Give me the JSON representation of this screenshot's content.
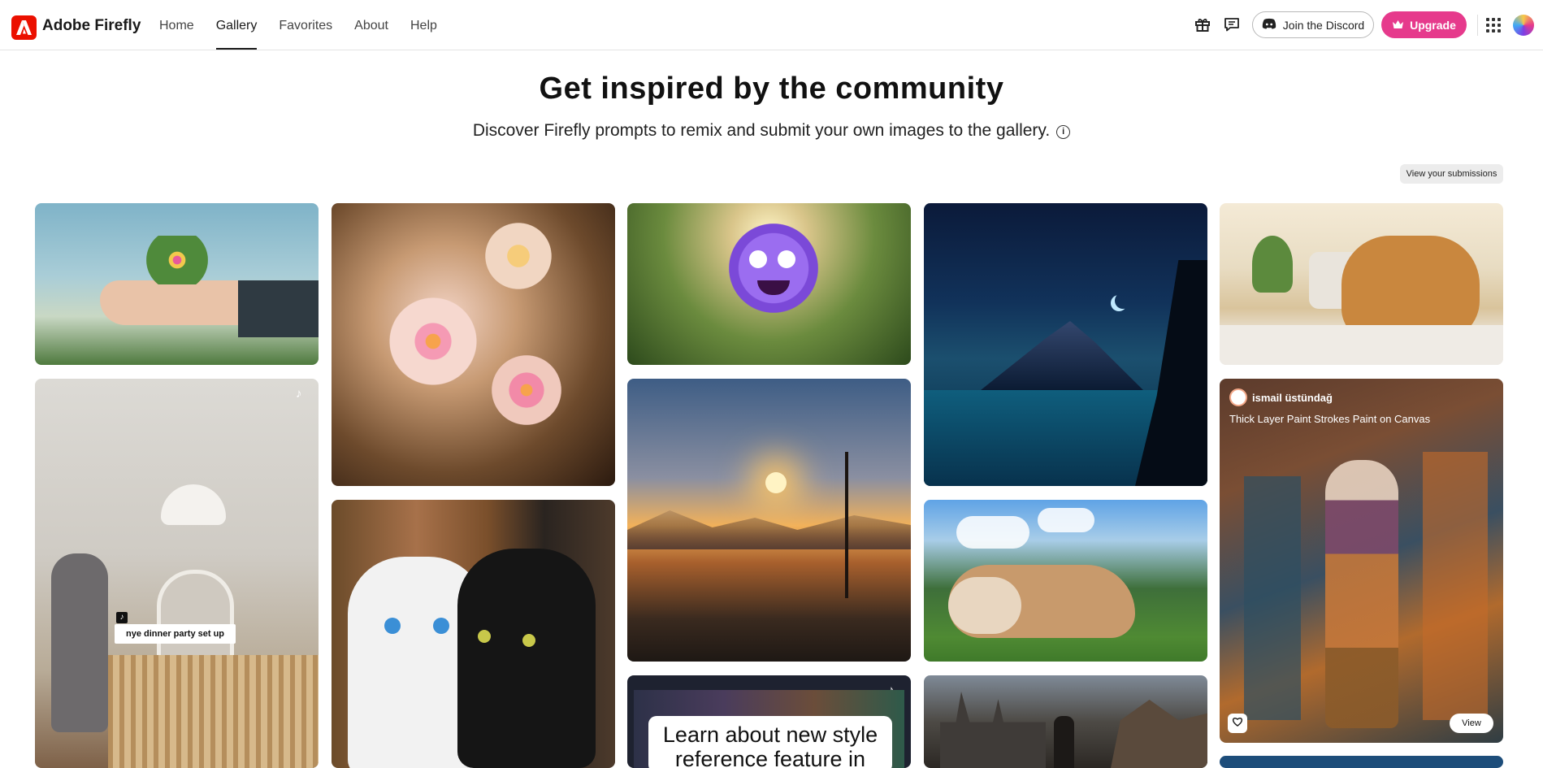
{
  "header": {
    "app_name": "Adobe Firefly",
    "nav": [
      {
        "label": "Home",
        "active": false
      },
      {
        "label": "Gallery",
        "active": true
      },
      {
        "label": "Favorites",
        "active": false
      },
      {
        "label": "About",
        "active": false
      },
      {
        "label": "Help",
        "active": false
      }
    ],
    "discord_label": "Join the Discord",
    "upgrade_label": "Upgrade",
    "icons": [
      "gift-icon",
      "feedback-icon",
      "discord-icon",
      "crown-icon",
      "apps-grid-icon",
      "avatar"
    ]
  },
  "hero": {
    "title": "Get inspired by the community",
    "subtitle": "Discover Firefly prompts to remix and submit your own images to the gallery."
  },
  "submissions_label": "View your submissions",
  "gallery": {
    "video_caption": "nye dinner party set up",
    "learn_card_text": "Learn about new style reference feature in",
    "featured": {
      "creator": "ismail üstündağ",
      "title": "Thick Layer Paint Strokes Paint on Canvas",
      "view_label": "View"
    }
  },
  "colors": {
    "accent_red": "#eb1000",
    "upgrade_pink": "#e63a8c"
  }
}
